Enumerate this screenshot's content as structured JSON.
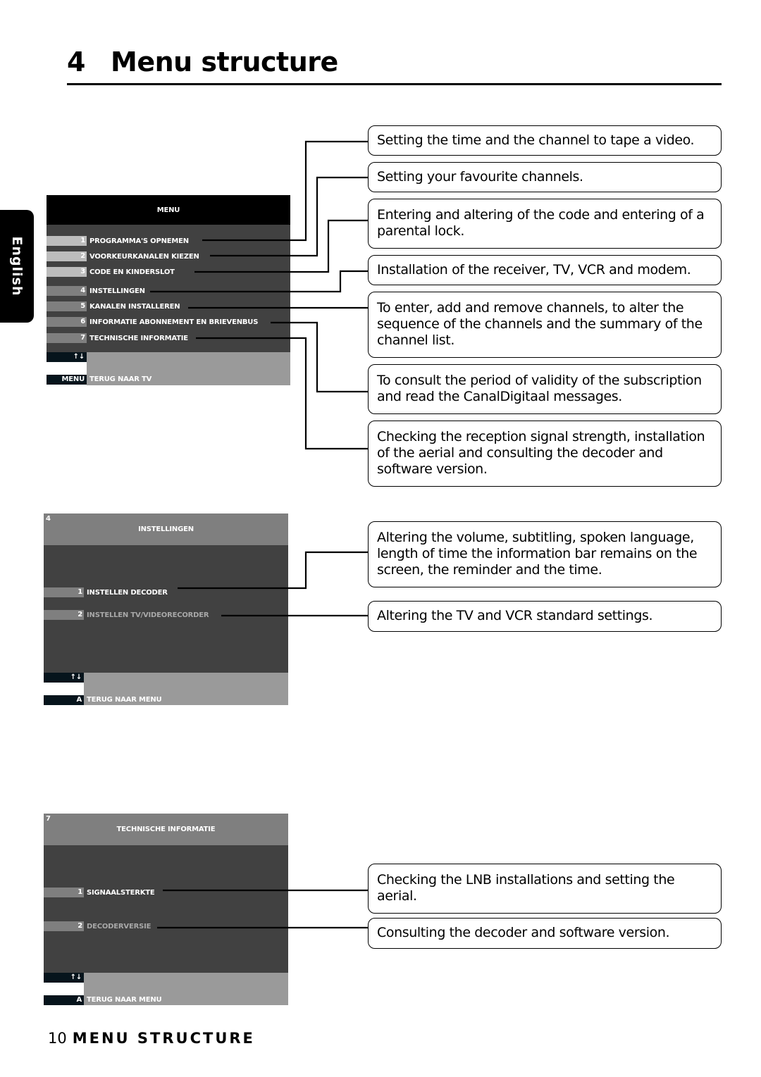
{
  "page": {
    "title_number": "4",
    "title": "Menu structure",
    "language_tab": "English",
    "footer_page_number": "10",
    "footer_section": "MENU STRUCTURE"
  },
  "menu_main": {
    "header": "MENU",
    "items": [
      {
        "num": "1",
        "label": "PROGRAMMA'S OPNEMEN"
      },
      {
        "num": "2",
        "label": "VOORKEURKANALEN KIEZEN"
      },
      {
        "num": "3",
        "label": "CODE EN KINDERSLOT"
      },
      {
        "num": "4",
        "label": "INSTELLINGEN"
      },
      {
        "num": "5",
        "label": "KANALEN INSTALLEREN"
      },
      {
        "num": "6",
        "label": "INFORMATIE ABONNEMENT EN BRIEVENBUS"
      },
      {
        "num": "7",
        "label": "TECHNISCHE INFORMATIE"
      }
    ],
    "nav_key": "↑↓",
    "back_key": "MENU",
    "back_label": "TERUG NAAR TV"
  },
  "menu_settings": {
    "number": "4",
    "header": "INSTELLINGEN",
    "items": [
      {
        "num": "1",
        "label": "INSTELLEN DECODER"
      },
      {
        "num": "2",
        "label": "INSTELLEN TV/VIDEORECORDER"
      }
    ],
    "nav_key": "↑↓",
    "back_key": "A",
    "back_label": "TERUG NAAR MENU"
  },
  "menu_technical": {
    "number": "7",
    "header": "TECHNISCHE INFORMATIE",
    "items": [
      {
        "num": "1",
        "label": "SIGNAALSTERKTE"
      },
      {
        "num": "2",
        "label": "DECODERVERSIE"
      }
    ],
    "nav_key": "↑↓",
    "back_key": "A",
    "back_label": "TERUG NAAR MENU"
  },
  "descriptions": {
    "main": [
      "Setting the time and the channel to tape a video.",
      "Setting your favourite channels.",
      "Entering and altering of the code and entering of a parental lock.",
      "Installation of the receiver, TV, VCR and modem.",
      "To enter, add and remove channels, to alter the sequence of the channels and the summary of the channel list.",
      "To consult the period of validity of the subscription and read the CanalDigitaal messages.",
      "Checking the reception signal strength, installation of the aerial and consulting the decoder and software version."
    ],
    "settings": [
      "Altering the volume, subtitling, spoken language, length of time the information bar remains on the screen, the reminder and the time.",
      "Altering the TV and VCR standard settings."
    ],
    "technical": [
      "Checking the LNB installations and setting the aerial.",
      "Consulting the decoder and software version."
    ]
  }
}
